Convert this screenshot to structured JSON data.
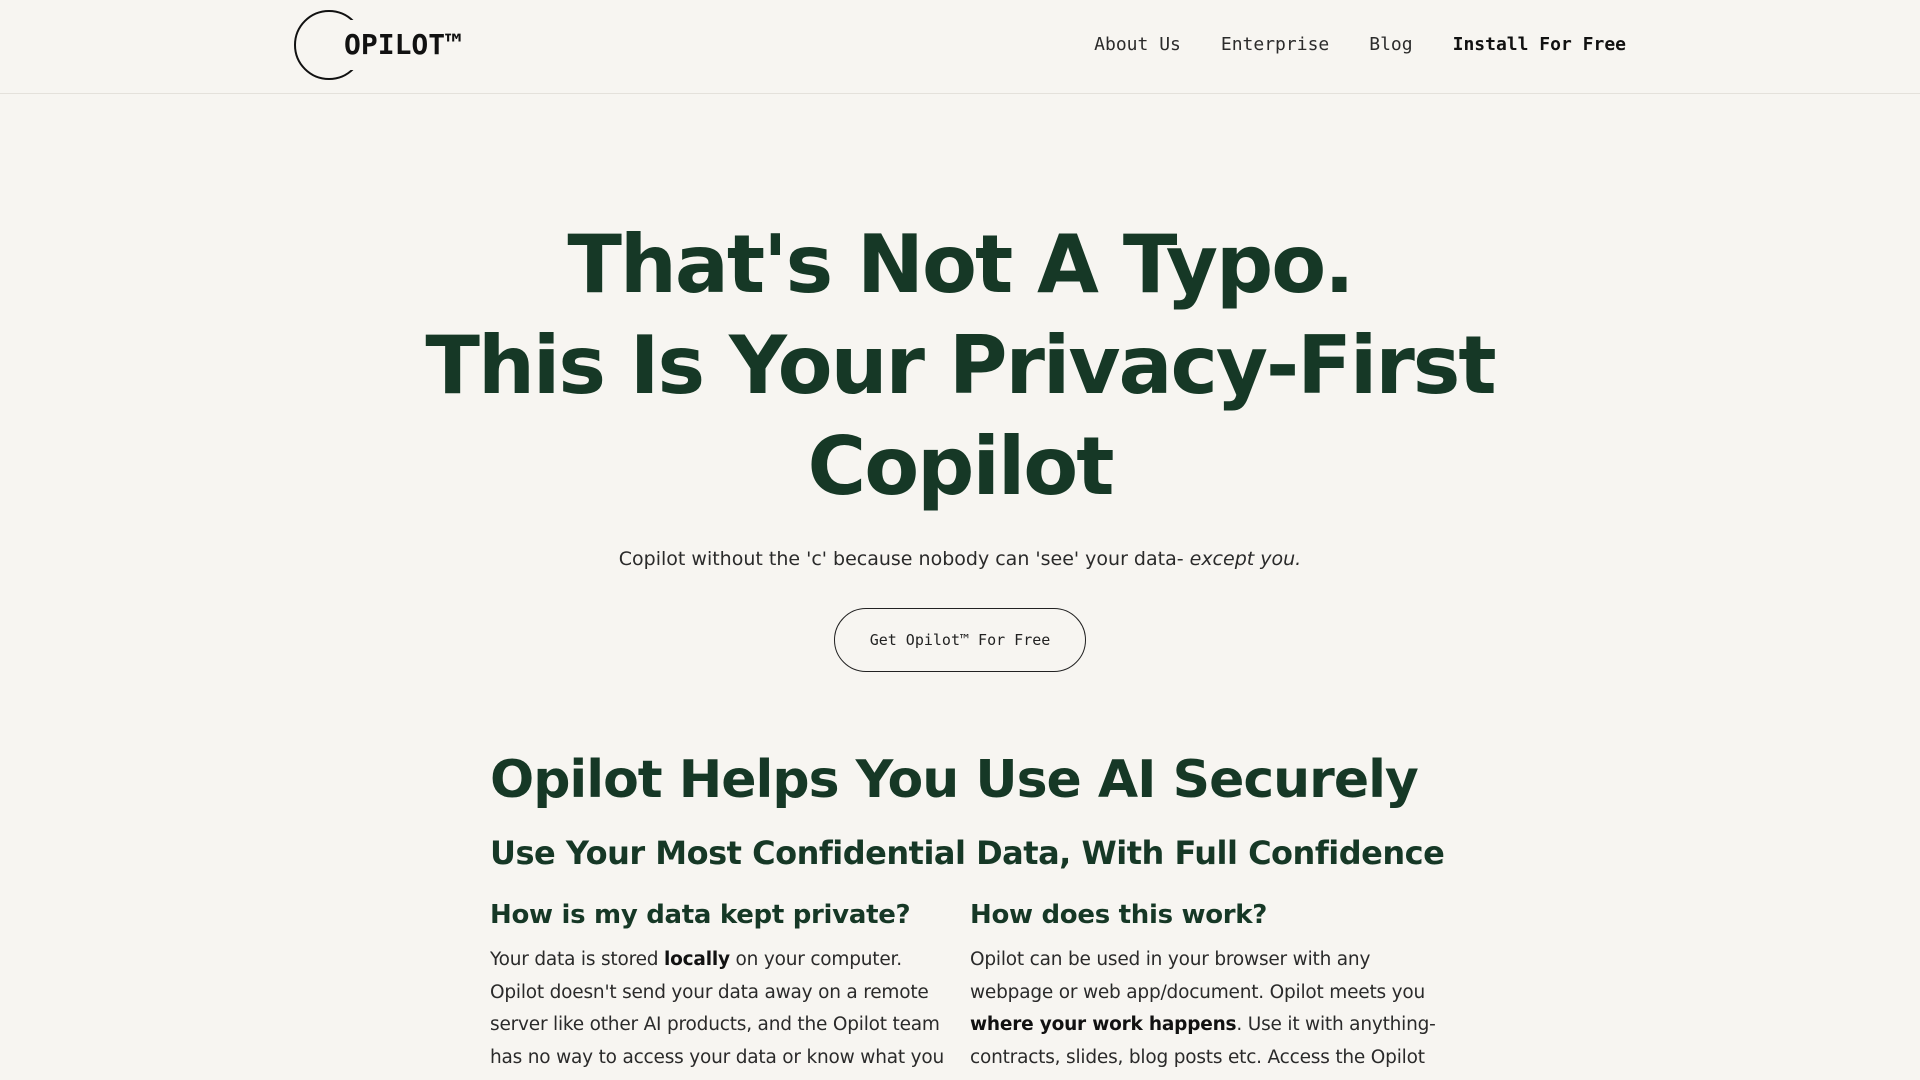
{
  "header": {
    "logo_text": "OPILOT™",
    "nav": [
      {
        "label": "About Us"
      },
      {
        "label": "Enterprise"
      },
      {
        "label": "Blog"
      },
      {
        "label": "Install For Free"
      }
    ]
  },
  "hero": {
    "title_line1": "That's Not A Typo.",
    "title_line2": "This Is Your Privacy-First",
    "title_line3": "Copilot",
    "subtitle_main": "Copilot without the 'c' because nobody can 'see' your data- ",
    "subtitle_emphasis": "except you.",
    "cta_label": "Get Opilot™ For Free"
  },
  "section": {
    "heading": "Opilot Helps You Use AI Securely",
    "subheading": "Use Your Most Confidential Data, With Full Confidence",
    "left": {
      "title": "How is my data kept private?",
      "p1_a": "Your data is stored ",
      "p1_bold": "locally",
      "p1_b": " on your computer.",
      "p2": "Opilot doesn't send your data away on a remote server like other AI products, and the Opilot team has no way to access your data or know what you are doing."
    },
    "right": {
      "title": "How does this work?",
      "p_a": "Opilot can be used in your browser with any webpage or web app/document. Opilot meets you ",
      "p_bold": "where your work happens",
      "p_b": ". Use it with anything- contracts, slides, blog posts etc. Access the Opilot AI tool by selecting"
    }
  }
}
